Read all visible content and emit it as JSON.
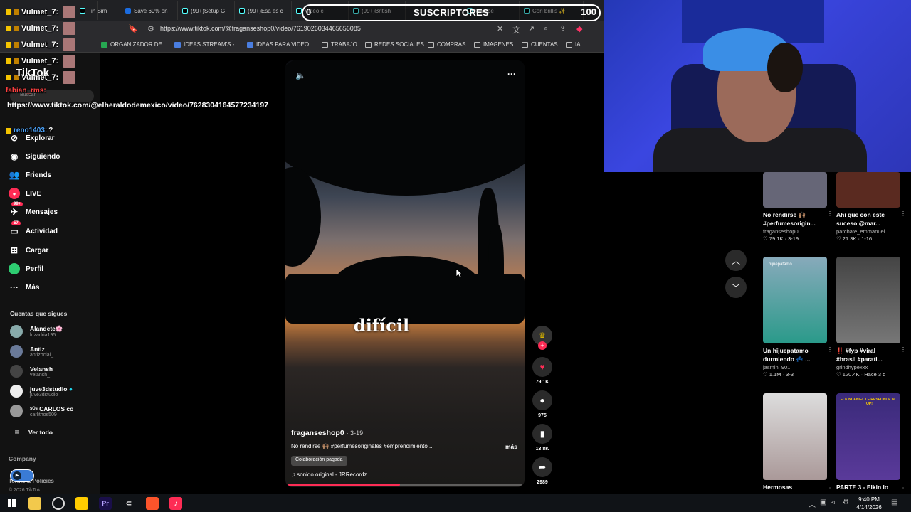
{
  "browser": {
    "tabs": [
      {
        "label": "in Sim"
      },
      {
        "label": "Save 69% on"
      },
      {
        "label": "(99+)Setup G"
      },
      {
        "label": "(99+)Esa es c"
      },
      {
        "label": "Video c"
      },
      {
        "label": "(99+)British"
      },
      {
        "label": "Campe"
      },
      {
        "label": "Cori brillis ✨"
      }
    ],
    "url": "https://www.tiktok.com/@fraganseshop0/video/7619026034465656085",
    "bookmarks": [
      {
        "label": "ORGANIZADOR DE...",
        "icon": "sheet"
      },
      {
        "label": "IDEAS STREAM'S -...",
        "icon": "doc"
      },
      {
        "label": "IDEAS PARA VIDEO...",
        "icon": "doc"
      },
      {
        "label": "TRABAJO",
        "icon": "folder"
      },
      {
        "label": "REDES SOCIALES",
        "icon": "folder"
      },
      {
        "label": "COMPRAS",
        "icon": "folder"
      },
      {
        "label": "IMAGENES",
        "icon": "folder"
      },
      {
        "label": "CUENTAS",
        "icon": "folder"
      },
      {
        "label": "IA",
        "icon": "folder"
      }
    ]
  },
  "subscribers": {
    "left": "0",
    "title": "SUSCRIPTORES",
    "right": "100"
  },
  "sidebar": {
    "logo": "TikTok",
    "search_placeholder": "Buscar",
    "items": [
      {
        "label": "Explorar",
        "icon": "compass-icon"
      },
      {
        "label": "Siguiendo",
        "icon": "following-icon"
      },
      {
        "label": "Friends",
        "icon": "friends-icon"
      },
      {
        "label": "LIVE",
        "icon": "live-icon"
      },
      {
        "label": "Mensajes",
        "icon": "message-icon",
        "badge": "99+"
      },
      {
        "label": "Actividad",
        "icon": "activity-icon",
        "badge": "57"
      },
      {
        "label": "Cargar",
        "icon": "upload-icon"
      },
      {
        "label": "Perfil",
        "icon": "profile-icon"
      },
      {
        "label": "Más",
        "icon": "more-icon"
      }
    ],
    "following_title": "Cuentas que sigues",
    "accounts": [
      {
        "name": "Alandete🌸",
        "handle": "luzadria195"
      },
      {
        "name": "Antiz",
        "handle": "antizocial_"
      },
      {
        "name": "Velansh",
        "handle": "velansh_"
      },
      {
        "name": "juve3dstudio",
        "handle": "juve3dstudio"
      },
      {
        "name": "ˢᴼˢ CARLOS ᴄᴏ",
        "handle": "carlithos509"
      }
    ],
    "see_all": "Ver todo",
    "footer_company": "Company",
    "footer_policies": "Terms & Policies",
    "footer_copy": "© 2026 TikTok"
  },
  "chat": [
    {
      "user": "Vulmet_7:",
      "style": "white"
    },
    {
      "user": "Vulmet_7:",
      "style": "white"
    },
    {
      "user": "Vulmet_7:",
      "style": "white"
    },
    {
      "user": "Vulmet_7:",
      "style": "white"
    },
    {
      "user": "Vulmet_7:",
      "style": "white"
    }
  ],
  "chat_extra": {
    "red_user": "fabian_rms:",
    "link": "https://www.tiktok.com/@elheraldodemexico/video/7628304164577234197",
    "blue_user": "reno1403:",
    "blue_msg": "?"
  },
  "video": {
    "caption_word": "difícil",
    "author": "fraganseshop0",
    "date": "· 3-19",
    "description": "No rendirse 🙌🏽 #perfumesoriginales #emprendimiento ...",
    "more": "más",
    "paid": "Colaboración pagada",
    "sound": "sonido original - JRRecordz",
    "progress": 0.48
  },
  "actions": [
    {
      "name": "like",
      "count": "79.1K"
    },
    {
      "name": "comment",
      "count": "975"
    },
    {
      "name": "save",
      "count": "13.8K"
    },
    {
      "name": "share",
      "count": "2989"
    }
  ],
  "cards": [
    {
      "title": "No rendirse 🙌🏽 #perfumesorigin...",
      "author": "fraganseshop0",
      "stats": "♡ 79.1K · 3-19"
    },
    {
      "title": "Ahí que con este suceso @mar...",
      "author": "parchate_emmanuel",
      "stats": "♡ 21.3K · 1-16"
    },
    {
      "title": "Un hijuepatamo durmiendo 💤 ...",
      "author": "jasmin_901",
      "stats": "♡ 1.1M · 3-3"
    },
    {
      "title": "‼️ #fyp #viral #brasil #parati...",
      "author": "grindhypexxx",
      "stats": "♡ 120.4K · Hace 3 d"
    },
    {
      "title": "Hermosas",
      "author": "",
      "stats": ""
    },
    {
      "title": "PARTE 3 - Elkin lo",
      "author": "",
      "stats": ""
    }
  ],
  "card_overlays": {
    "c3": "hijuepatamo",
    "c6": "ELKINDANIEL LE RESPONDE AL TOP!"
  },
  "taskbar": {
    "time": "9:40 PM",
    "date": "4/14/2026"
  },
  "colors": {
    "accent": "#fe2c55",
    "bg": "#000000",
    "sidebar": "#121212"
  }
}
